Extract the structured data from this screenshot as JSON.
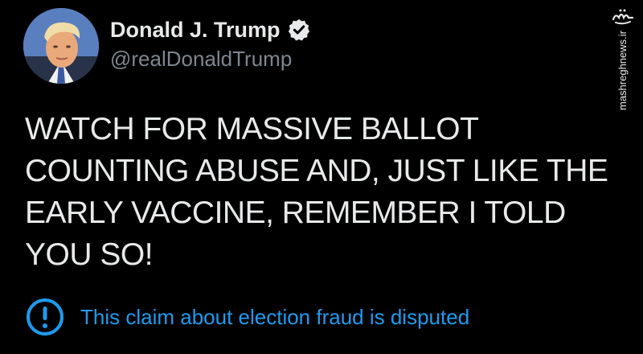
{
  "author": {
    "display_name": "Donald J. Trump",
    "handle": "@realDonaldTrump",
    "verified": true
  },
  "tweet": {
    "text": "WATCH FOR MASSIVE BALLOT\nCOUNTING ABUSE AND, JUST LIKE THE\nEARLY VACCINE, REMEMBER I TOLD\nYOU SO!"
  },
  "notice": {
    "icon": "exclamation-circle-icon",
    "text": "This claim about election fraud is disputed"
  },
  "watermark": {
    "site": "mashreghnews.ir",
    "logo": "مشرق"
  },
  "colors": {
    "background": "#000000",
    "primary_text": "#e7e9ea",
    "secondary_text": "#7e868e",
    "accent": "#1d9bf0"
  }
}
